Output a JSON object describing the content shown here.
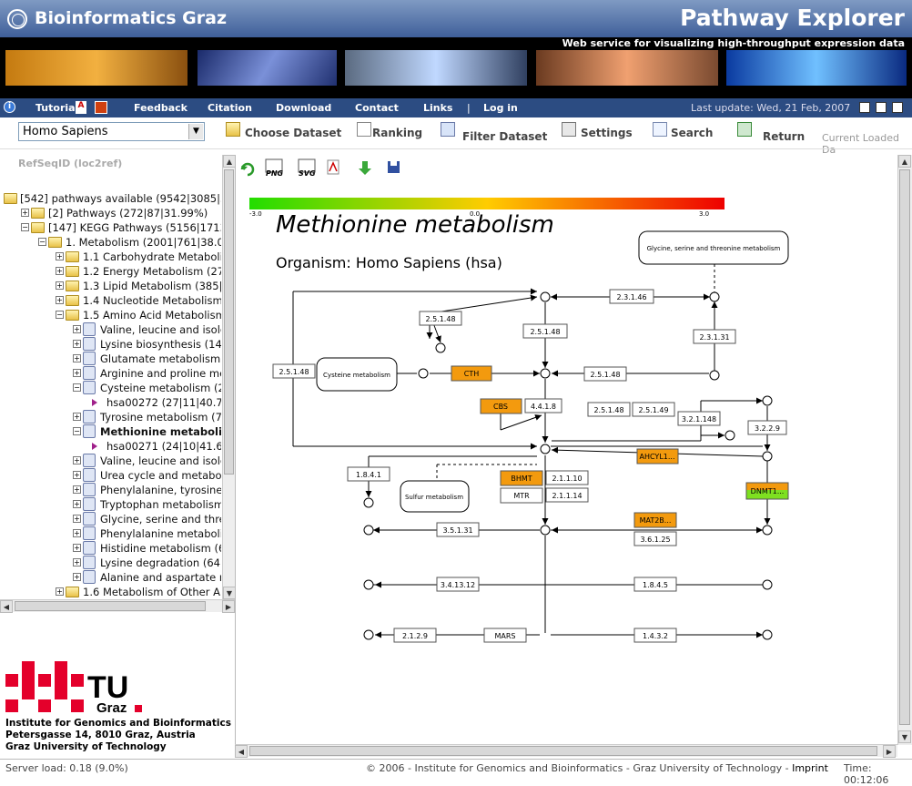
{
  "header": {
    "brand": "Bioinformatics Graz",
    "title": "Pathway Explorer",
    "tagline": "Web service for visualizing high-throughput expression data"
  },
  "nav": {
    "tutorial": "Tutorial",
    "feedback": "Feedback",
    "citation": "Citation",
    "download": "Download",
    "contact": "Contact",
    "links": "Links",
    "login": "Log in",
    "last_update": "Last update: Wed, 21 Feb, 2007"
  },
  "toolbar": {
    "organism": "Homo Sapiens",
    "choose_dataset": "Choose Dataset",
    "ranking": "Ranking",
    "filter_dataset": "Filter Dataset",
    "settings": "Settings",
    "search": "Search",
    "return": "Return",
    "current_loaded": "Current Loaded Da"
  },
  "refseq": "RefSeqID (loc2ref)",
  "tree": [
    "[542] pathways available (9542|3085|32",
    "[2] Pathways (272|87|31.99%)",
    "[147] KEGG Pathways (5156|1713|33",
    "1. Metabolism (2001|761|38.03%",
    "1.1 Carbohydrate Metabolism",
    "1.2 Energy Metabolism (272|1",
    "1.3 Lipid Metabolism (385|153",
    "1.4 Nucleotide Metabolism (28",
    "1.5 Amino Acid Metabolism (45",
    "Valine, leucine and isoleuci",
    "Lysine biosynthesis (14|8|",
    "Glutamate metabolism (38|",
    "Arginine and proline metab",
    "Cysteine metabolism (27|1",
    "hsa00272 (27|11|40.7",
    "Tyrosine metabolism (77|2",
    "Methionine metabolism",
    "hsa00271 (24|10|41.67",
    "Valine, leucine and isoleuci",
    "Urea cycle and metabolism",
    "Phenylalanine, tyrosine and",
    "Tryptophan metabolism (1",
    "Glycine, serine and threoni",
    "Phenylalanine metabolism (",
    "Histidine metabolism (66|2",
    "Lysine degradation (64|34",
    "Alanine and aspartate meta",
    "1.6 Metabolism of Other Amino"
  ],
  "view_tools": {
    "png": "PNG",
    "svg": "SVG"
  },
  "diagram": {
    "title": "Methionine metabolism",
    "organism": "Organism: Homo Sapiens (hsa)",
    "scale": {
      "min": "-3.0",
      "mid": "0.0",
      "max": "3.0"
    },
    "colors": {
      "up": "#f39a0e",
      "mid": "#ffcc00",
      "low": "#22dd00",
      "high": "#ee0000"
    },
    "genes": {
      "cth": "CTH",
      "cbs": "CBS",
      "bhmt": "BHMT",
      "mtr": "MTR",
      "ahcyl": "AHCYL1...",
      "mat2b": "MAT2B...",
      "dnmt": "DNMT1...",
      "mars": "MARS"
    },
    "ecs": {
      "e2_3_1_46": "2.3.1.46",
      "e2_5_1_48a": "2.5.1.48",
      "e2_5_1_48b": "2.5.1.48",
      "e2_5_1_48c": "2.5.1.48",
      "e2_5_1_48d": "2.5.1.48",
      "e2_5_1_48e": "2.5.1.48",
      "e2_3_1_31": "2.3.1.31",
      "e4_4_1_8": "4.4.1.8",
      "e2_5_1_49": "2.5.1.49",
      "e3_2_1_148": "3.2.1.148",
      "e3_2_2_9": "3.2.2.9",
      "e1_8_4_1": "1.8.4.1",
      "e2_1_1_10": "2.1.1.10",
      "e2_1_1_14": "2.1.1.14",
      "e3_5_1_31": "3.5.1.31",
      "e3_6_1_25": "3.6.1.25",
      "e3_4_13_12": "3.4.13.12",
      "e1_8_4_5": "1.8.4.5",
      "e2_1_2_9": "2.1.2.9",
      "e1_4_3_2": "1.4.3.2"
    },
    "maps": {
      "cysteine": "Cysteine metabolism",
      "sulfur": "Sulfur metabolism",
      "glycine": "Glycine, serine and threonine metabolism"
    }
  },
  "footer": {
    "load": "Server load: 0.18 (9.0%)",
    "copyright": "© 2006 - Institute for Genomics and Bioinformatics - Graz University of Technology - ",
    "imprint": "Imprint",
    "time": "Time: 00:12:06"
  },
  "institute": {
    "line1": "Institute for Genomics and Bioinformatics",
    "line2": "Petersgasse 14, 8010 Graz, Austria",
    "line3": "Graz University of Technology"
  },
  "tu_logo": {
    "tu": "TU",
    "graz": "Graz"
  }
}
